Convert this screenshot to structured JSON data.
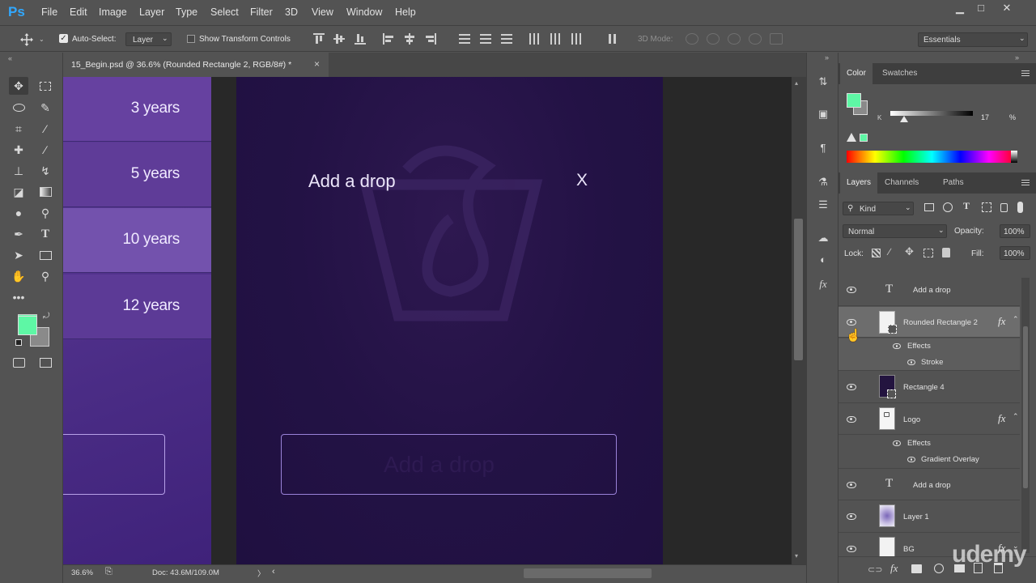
{
  "app": {
    "logo": "Ps"
  },
  "menu": [
    "File",
    "Edit",
    "Image",
    "Layer",
    "Type",
    "Select",
    "Filter",
    "3D",
    "View",
    "Window",
    "Help"
  ],
  "window_controls": {
    "minimize": "▁",
    "restore": "□",
    "close": "✕"
  },
  "options_bar": {
    "auto_select_label": "Auto-Select:",
    "auto_select_checked": true,
    "auto_select_target": "Layer",
    "show_transform_label": "Show Transform Controls",
    "show_transform_checked": false,
    "mode_3d_label": "3D Mode:",
    "workspace": "Essentials"
  },
  "document_tab": {
    "title": "15_Begin.psd @ 36.6% (Rounded Rectangle 2, RGB/8#) *",
    "close": "×"
  },
  "canvas": {
    "left_artboard": {
      "items": [
        "3 years",
        "5 years",
        "10 years",
        "12 years"
      ]
    },
    "main_artboard": {
      "title": "Add a drop",
      "close": "X",
      "input_placeholder": "Add a drop"
    }
  },
  "status_bar": {
    "zoom": "36.6%",
    "doc_size": "Doc: 43.6M/109.0M",
    "arrow_right": "〉",
    "arrow_left": "‹"
  },
  "color_panel": {
    "tabs": [
      "Color",
      "Swatches"
    ],
    "active_tab": "Color",
    "channel": "K",
    "value": "17",
    "unit": "%",
    "foreground": "#5ef7a5",
    "background": "#8a8a8a"
  },
  "layers_panel": {
    "tabs": [
      "Layers",
      "Channels",
      "Paths"
    ],
    "active_tab": "Layers",
    "filter_kind": "Kind",
    "blend_mode": "Normal",
    "opacity_label": "Opacity:",
    "opacity": "100%",
    "lock_label": "Lock:",
    "fill_label": "Fill:",
    "fill": "100%",
    "layers": [
      {
        "name": "Add a drop",
        "kind": "text"
      },
      {
        "name": "Rounded Rectangle 2",
        "kind": "shape",
        "selected": true,
        "fx": "fx",
        "effects_label": "Effects",
        "effects": [
          "Stroke"
        ]
      },
      {
        "name": "Rectangle 4",
        "kind": "shape-dark"
      },
      {
        "name": "Logo",
        "kind": "logo",
        "fx": "fx",
        "effects_label": "Effects",
        "effects": [
          "Gradient Overlay"
        ]
      },
      {
        "name": "Add a drop",
        "kind": "text"
      },
      {
        "name": "Layer 1",
        "kind": "image"
      },
      {
        "name": "BG",
        "kind": "bg",
        "fx": "fx"
      }
    ]
  },
  "tools": {
    "foreground_color": "#5ef7a5",
    "background_color": "#8a8a8a"
  },
  "watermark": "udemy"
}
